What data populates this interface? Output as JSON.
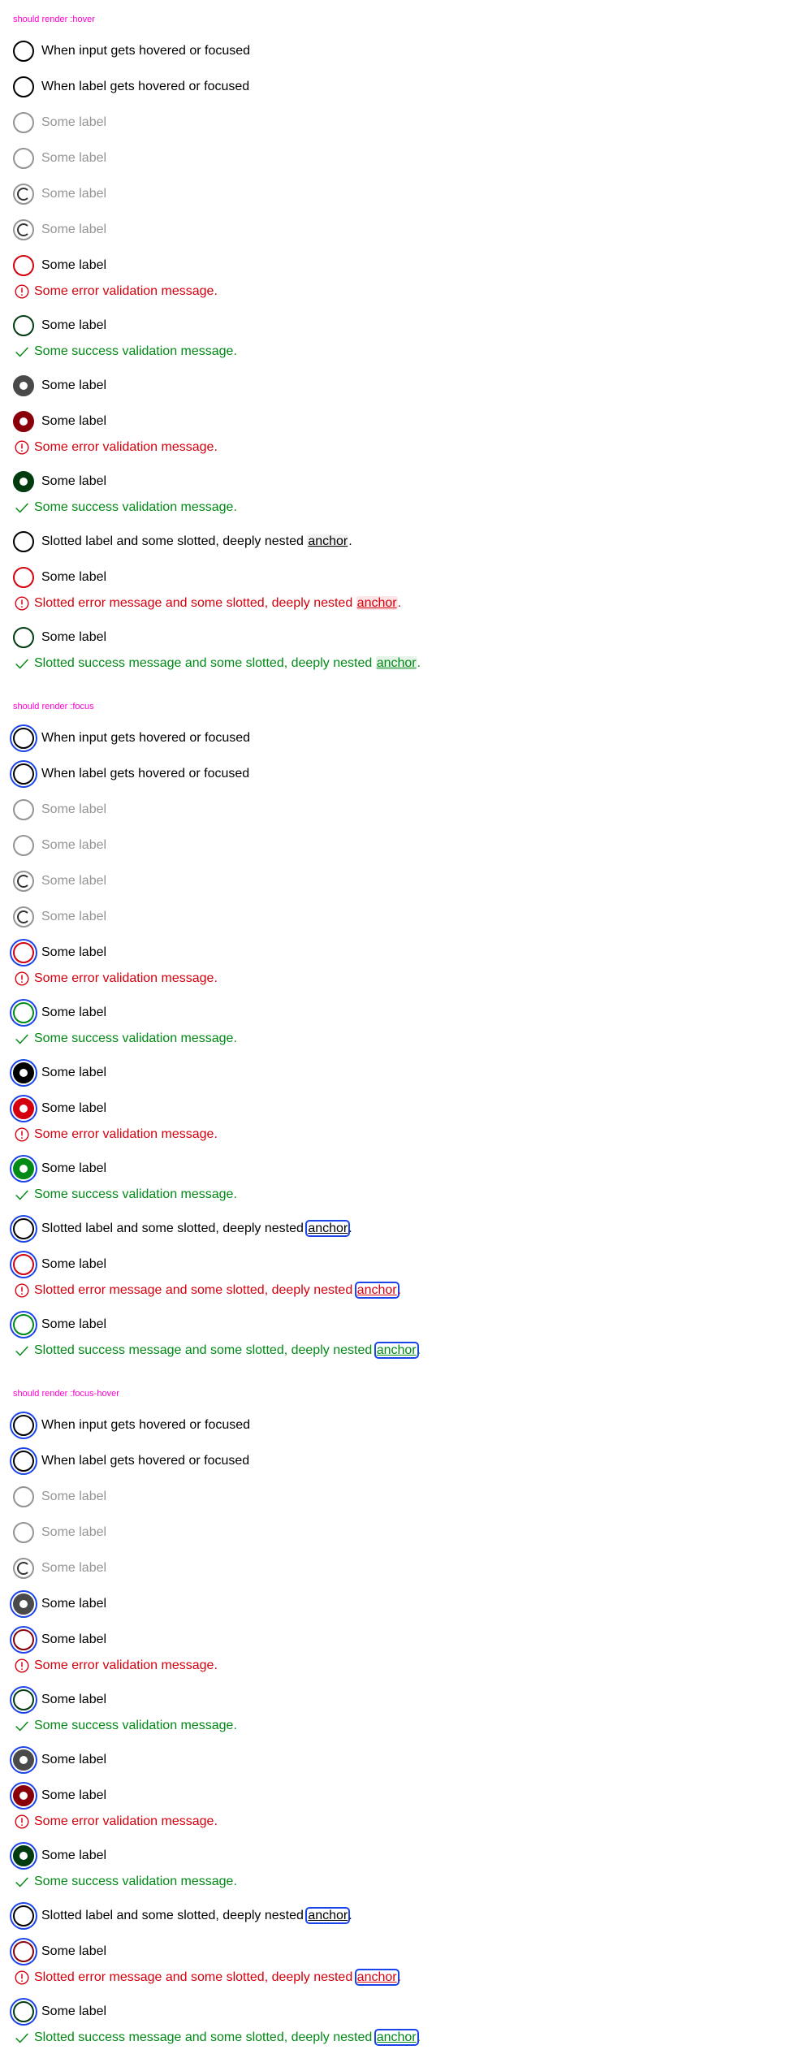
{
  "sections": [
    {
      "title": "should render :hover",
      "rows": [
        {
          "type": "radio",
          "state": "default",
          "label": "When input gets hovered or focused"
        },
        {
          "type": "radio",
          "state": "default",
          "label": "When label gets hovered or focused"
        },
        {
          "type": "radio",
          "state": "disabled",
          "label": "Some label"
        },
        {
          "type": "radio",
          "state": "disabled",
          "label": "Some label"
        },
        {
          "type": "radio",
          "state": "loading",
          "label": "Some label"
        },
        {
          "type": "radio",
          "state": "loading",
          "label": "Some label"
        },
        {
          "type": "radio",
          "state": "error",
          "label": "Some label"
        },
        {
          "type": "msg",
          "kind": "error",
          "text": "Some error validation message."
        },
        {
          "type": "radio",
          "state": "dk-success",
          "label": "Some label"
        },
        {
          "type": "msg",
          "kind": "success",
          "text": "Some success validation message."
        },
        {
          "type": "radio",
          "state": "checked-dark",
          "label": "Some label"
        },
        {
          "type": "radio",
          "state": "checked-dk-error",
          "label": "Some label"
        },
        {
          "type": "msg",
          "kind": "error",
          "text": "Some error validation message."
        },
        {
          "type": "radio",
          "state": "checked-dk-success",
          "label": "Some label"
        },
        {
          "type": "msg",
          "kind": "success",
          "text": "Some success validation message."
        },
        {
          "type": "radio",
          "state": "default",
          "label": "Slotted label and some slotted, deeply nested ",
          "anchor": "anchor",
          "after": "."
        },
        {
          "type": "radio",
          "state": "error",
          "label": "Some label"
        },
        {
          "type": "msg",
          "kind": "error",
          "text": "Slotted error message and some slotted, deeply nested ",
          "anchor": "anchor",
          "after": "."
        },
        {
          "type": "radio",
          "state": "dk-success",
          "label": "Some label"
        },
        {
          "type": "msg",
          "kind": "success",
          "text": "Slotted success message and some slotted, deeply nested ",
          "anchor": "anchor",
          "after": "."
        }
      ]
    },
    {
      "title": "should render :focus",
      "rows": [
        {
          "type": "radio",
          "state": "focus-default",
          "label": "When input gets hovered or focused"
        },
        {
          "type": "radio",
          "state": "focus-default",
          "label": "When label gets hovered or focused"
        },
        {
          "type": "radio",
          "state": "disabled",
          "label": "Some label"
        },
        {
          "type": "radio",
          "state": "disabled",
          "label": "Some label"
        },
        {
          "type": "radio",
          "state": "loading",
          "label": "Some label"
        },
        {
          "type": "radio",
          "state": "loading",
          "label": "Some label"
        },
        {
          "type": "radio",
          "state": "focus-error",
          "label": "Some label"
        },
        {
          "type": "msg",
          "kind": "error",
          "text": "Some error validation message."
        },
        {
          "type": "radio",
          "state": "focus-success",
          "label": "Some label"
        },
        {
          "type": "msg",
          "kind": "success",
          "text": "Some success validation message."
        },
        {
          "type": "radio",
          "state": "focus-checked-black",
          "label": "Some label"
        },
        {
          "type": "radio",
          "state": "focus-checked-red",
          "label": "Some label"
        },
        {
          "type": "msg",
          "kind": "error",
          "text": "Some error validation message."
        },
        {
          "type": "radio",
          "state": "focus-checked-green",
          "label": "Some label"
        },
        {
          "type": "msg",
          "kind": "success",
          "text": "Some success validation message."
        },
        {
          "type": "radio",
          "state": "focus-default",
          "label": "Slotted label and some slotted, deeply nested ",
          "anchor": "anchor",
          "after": ".",
          "anchorFocus": true
        },
        {
          "type": "radio",
          "state": "focus-error",
          "label": "Some label"
        },
        {
          "type": "msg",
          "kind": "error",
          "text": "Slotted error message and some slotted, deeply nested ",
          "anchor": "anchor",
          "after": ".",
          "anchorFocus": true
        },
        {
          "type": "radio",
          "state": "focus-success",
          "label": "Some label"
        },
        {
          "type": "msg",
          "kind": "success",
          "text": "Slotted success message and some slotted, deeply nested ",
          "anchor": "anchor",
          "after": ".",
          "anchorFocus": true
        }
      ]
    },
    {
      "title": "should render :focus-hover",
      "rows": [
        {
          "type": "radio",
          "state": "focus-default",
          "label": "When input gets hovered or focused"
        },
        {
          "type": "radio",
          "state": "focus-default",
          "label": "When label gets hovered or focused"
        },
        {
          "type": "radio",
          "state": "disabled",
          "label": "Some label"
        },
        {
          "type": "radio",
          "state": "disabled",
          "label": "Some label"
        },
        {
          "type": "radio",
          "state": "loading",
          "label": "Some label"
        },
        {
          "type": "radio",
          "state": "focus-checked-gray",
          "label": "Some label"
        },
        {
          "type": "radio",
          "state": "focus-dk-error",
          "label": "Some label"
        },
        {
          "type": "msg",
          "kind": "error",
          "text": "Some error validation message."
        },
        {
          "type": "radio",
          "state": "focus-dk-success",
          "label": "Some label"
        },
        {
          "type": "msg",
          "kind": "success",
          "text": "Some success validation message."
        },
        {
          "type": "radio",
          "state": "focus-checked-gray",
          "label": "Some label"
        },
        {
          "type": "radio",
          "state": "focus-checked-dk-error",
          "label": "Some label"
        },
        {
          "type": "msg",
          "kind": "error",
          "text": "Some error validation message."
        },
        {
          "type": "radio",
          "state": "focus-checked-dk-success",
          "label": "Some label"
        },
        {
          "type": "msg",
          "kind": "success",
          "text": "Some success validation message."
        },
        {
          "type": "radio",
          "state": "focus-default",
          "label": "Slotted label and some slotted, deeply nested ",
          "anchor": "anchor",
          "after": ".",
          "anchorFocus": true
        },
        {
          "type": "radio",
          "state": "focus-dk-error",
          "label": "Some label"
        },
        {
          "type": "msg",
          "kind": "error",
          "text": "Slotted error message and some slotted, deeply nested ",
          "anchor": "anchor",
          "after": ".",
          "anchorFocus": true
        },
        {
          "type": "radio",
          "state": "focus-dk-success",
          "label": "Some label"
        },
        {
          "type": "msg",
          "kind": "success",
          "text": "Slotted success message and some slotted, deeply nested ",
          "anchor": "anchor",
          "after": ".",
          "anchorFocus": true
        }
      ]
    }
  ],
  "colors": {
    "title": "#ff00d2",
    "error": "#d5000d",
    "success": "#018a16",
    "focus": "#1a44ea",
    "disabled": "#949494"
  }
}
